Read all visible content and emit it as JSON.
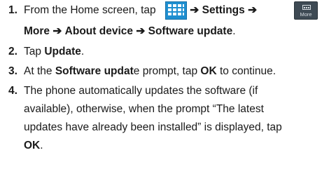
{
  "steps": [
    {
      "number": "1.",
      "line1": {
        "pre": "From the Home screen, tap",
        "arrow1": "➔",
        "settings": "Settings",
        "arrow2": "➔"
      },
      "line2": {
        "more": "More",
        "arrow3": "➔",
        "about": "About device",
        "arrow4": "➔",
        "update": "Software update",
        "end": "."
      },
      "more_icon_label": "More",
      "apps_icon": "apps-grid-icon",
      "more_icon": "more-menu-icon"
    },
    {
      "number": "2.",
      "pre": "Tap ",
      "update": "Update",
      "end": "."
    },
    {
      "number": "3.",
      "pre": "At the ",
      "prompt_bold": "Software updat",
      "prompt_rest": "e prompt, tap ",
      "ok": "OK",
      "end": " to continue."
    },
    {
      "number": "4.",
      "lines": [
        "The phone automatically updates the software (if",
        "available), otherwise, when the prompt “The latest",
        "updates have already been installed” is displayed, tap"
      ],
      "ok": "OK",
      "end": "."
    }
  ],
  "colors": {
    "apps_icon": "#1f8fd0",
    "more_icon": "#3e4a54",
    "text": "#1a1a1a"
  }
}
